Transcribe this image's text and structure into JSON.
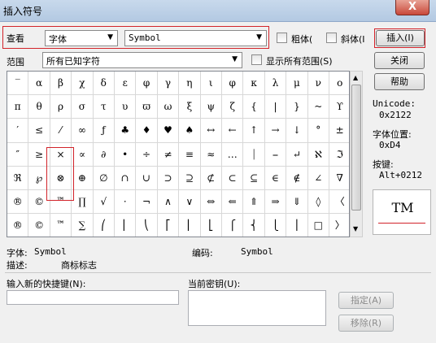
{
  "window": {
    "title": "插入符号",
    "close": "X"
  },
  "toolbar": {
    "view_label": "查看",
    "view_value": "字体",
    "font_value": "Symbol",
    "bold_label": "粗体(",
    "italic_label": "斜体(I",
    "range_label": "范围",
    "range_value": "所有已知字符",
    "show_all_label": "显示所有范围(S)"
  },
  "buttons": {
    "insert": "插入(I)",
    "close": "关闭",
    "help": "帮助",
    "assign": "指定(A)",
    "remove": "移除(R)"
  },
  "info": {
    "unicode_label": "Unicode:",
    "unicode_value": "0x2122",
    "charpos_label": "字体位置:",
    "charpos_value": "0xD4",
    "keys_label": "按键:",
    "keys_value": "Alt+0212"
  },
  "preview_char": "TM",
  "status": {
    "font_label": "字体:",
    "font_value": "Symbol",
    "encoding_label": "编码:",
    "encoding_value": "Symbol",
    "desc_label": "描述:",
    "desc_value": "商标标志"
  },
  "shortcut": {
    "new_label": "输入新的快捷键(N):",
    "current_label": "当前密钥(U):"
  },
  "grid_rows": [
    [
      "‾",
      "α",
      "β",
      "χ",
      "δ",
      "ε",
      "φ",
      "γ",
      "η",
      "ι",
      "φ",
      "κ",
      "λ",
      "μ",
      "ν",
      "ο"
    ],
    [
      "π",
      "θ",
      "ρ",
      "σ",
      "τ",
      "υ",
      "ϖ",
      "ω",
      "ξ",
      "ψ",
      "ζ",
      "{",
      "|",
      "}",
      "~",
      "ϒ"
    ],
    [
      "′",
      "≤",
      "⁄",
      "∞",
      "ƒ",
      "♣",
      "♦",
      "♥",
      "♠",
      "↔",
      "←",
      "↑",
      "→",
      "↓",
      "°",
      "±"
    ],
    [
      "″",
      "≥",
      "×",
      "∝",
      "∂",
      "•",
      "÷",
      "≠",
      "≡",
      "≈",
      "…",
      "⏐",
      "⎯",
      "↵",
      "ℵ",
      "ℑ"
    ],
    [
      "ℜ",
      "℘",
      "⊗",
      "⊕",
      "∅",
      "∩",
      "∪",
      "⊃",
      "⊇",
      "⊄",
      "⊂",
      "⊆",
      "∈",
      "∉",
      "∠",
      "∇"
    ],
    [
      "®",
      "©",
      "™",
      "∏",
      "√",
      "⋅",
      "¬",
      "∧",
      "∨",
      "⇔",
      "⇐",
      "⇑",
      "⇒",
      "⇓",
      "◊",
      "〈"
    ],
    [
      "®",
      "©",
      "™",
      "∑",
      "⎛",
      "⎜",
      "⎝",
      "⎡",
      "⎢",
      "⎣",
      "⎧",
      "⎨",
      "⎩",
      "⎪",
      "□",
      "〉"
    ],
    [
      "∫",
      "⌠",
      "⎮",
      "⌡",
      "⎞",
      "⎟",
      "⎠",
      "⎤",
      "⎥",
      "⎦",
      "⎫",
      "⎬",
      "⎭",
      "",
      "",
      ""
    ]
  ]
}
